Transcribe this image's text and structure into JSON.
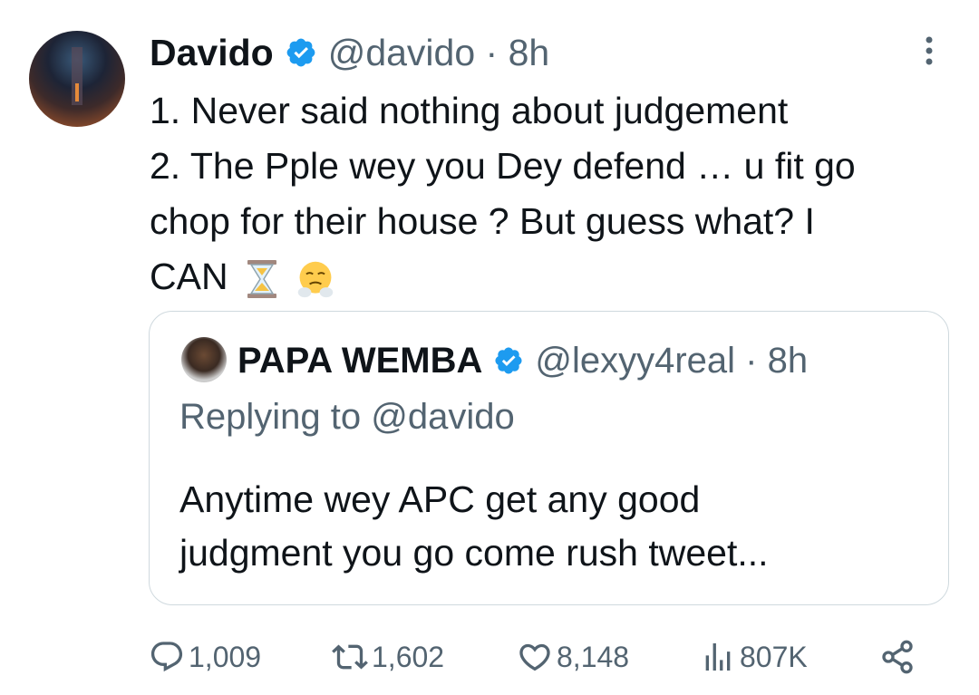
{
  "tweet": {
    "author_name": "Davido",
    "handle_time": "@davido · 8h",
    "lines": [
      "1. Never said nothing about judgement",
      "2. The Pple wey you Dey defend … u fit go",
      "chop for their house ? But guess what? I",
      "CAN"
    ],
    "emojis": [
      "hourglass-icon",
      "face-steam-nose-icon"
    ]
  },
  "quoted": {
    "author_name": "PAPA WEMBA",
    "handle_time": "@lexyy4real · 8h",
    "replying_to": "Replying to @davido",
    "lines": [
      "Anytime wey APC get any good",
      "judgment you go come rush tweet..."
    ]
  },
  "actions": {
    "replies": "1,009",
    "retweets": "1,602",
    "likes": "8,148",
    "views": "807K"
  },
  "colors": {
    "text": "#0f1419",
    "secondary": "#536471",
    "verified": "#1d9bf0",
    "border": "#cfd9de"
  }
}
